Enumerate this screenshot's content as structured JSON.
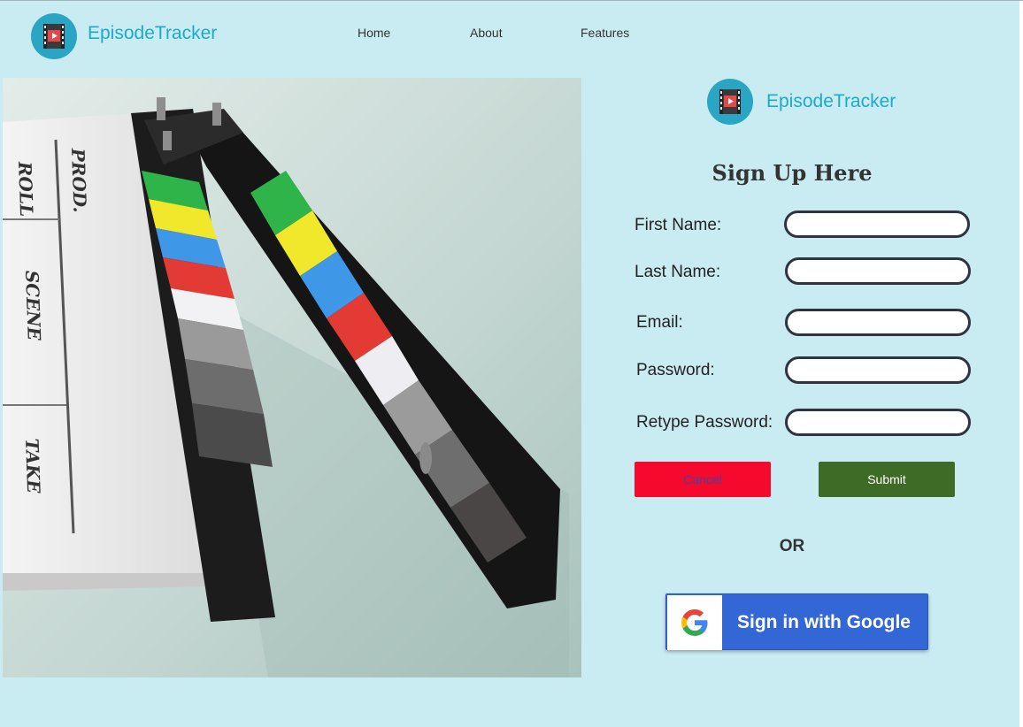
{
  "brand": {
    "name": "EpisodeTracker"
  },
  "nav": {
    "items": [
      "Home",
      "About",
      "Features"
    ]
  },
  "form": {
    "title": "Sign Up Here",
    "fields": [
      {
        "label": "First Name:",
        "value": ""
      },
      {
        "label": "Last Name:",
        "value": ""
      },
      {
        "label": "Email:",
        "value": ""
      },
      {
        "label": "Password:",
        "value": ""
      },
      {
        "label": "Retype Password:",
        "value": ""
      }
    ],
    "cancel_label": "Cancel",
    "submit_label": "Submit",
    "or_label": "OR",
    "google_label": "Sign in with Google"
  },
  "colors": {
    "background": "#c9ecf2",
    "brand": "#1fa9c9",
    "cancel": "#f50a2d",
    "submit": "#3e6b26",
    "google": "#3367d6"
  },
  "icons": {
    "logo": "film-play-icon",
    "google": "google-g-icon"
  },
  "hero": {
    "slate_labels": [
      "ROLL",
      "PROD.",
      "SCENE",
      "TAKE"
    ]
  }
}
